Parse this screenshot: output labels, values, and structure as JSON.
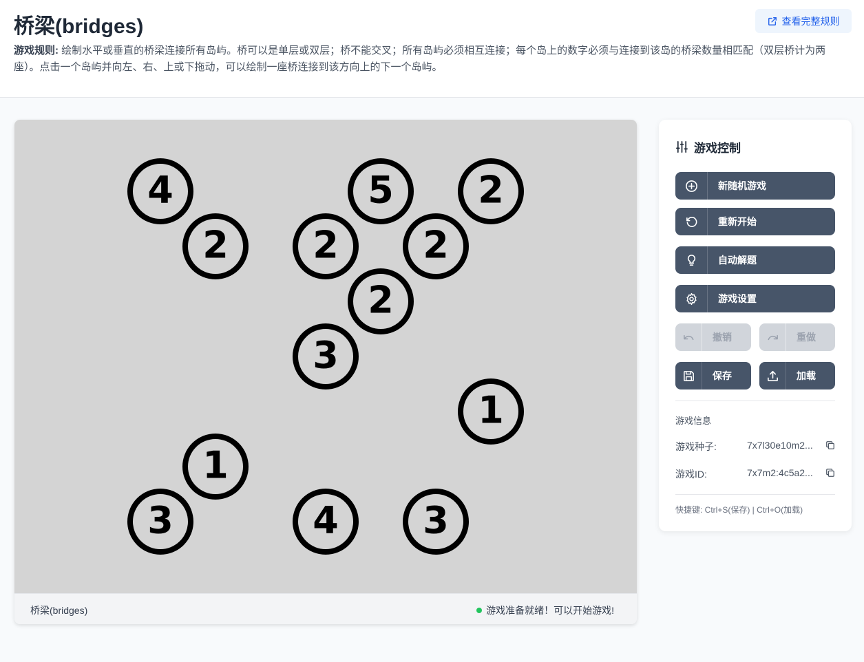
{
  "header": {
    "title": "桥梁(bridges)",
    "rules_label": "游戏规则:",
    "rules_text": "绘制水平或垂直的桥梁连接所有岛屿。桥可以是单层或双层；桥不能交叉；所有岛屿必须相互连接；每个岛上的数字必须与连接到该岛的桥梁数量相匹配（双层桥计为两座）。点击一个岛屿并向左、右、上或下拖动，可以绘制一座桥连接到该方向上的下一个岛屿。",
    "rules_link": "查看完整规则"
  },
  "board": {
    "grid_cols": 11,
    "grid_rows": 8,
    "islands": [
      {
        "col": 2,
        "row": 0,
        "value": "4"
      },
      {
        "col": 6,
        "row": 0,
        "value": "5"
      },
      {
        "col": 8,
        "row": 0,
        "value": "2"
      },
      {
        "col": 3,
        "row": 1,
        "value": "2"
      },
      {
        "col": 5,
        "row": 1,
        "value": "2"
      },
      {
        "col": 7,
        "row": 1,
        "value": "2"
      },
      {
        "col": 6,
        "row": 2,
        "value": "2"
      },
      {
        "col": 5,
        "row": 3,
        "value": "3"
      },
      {
        "col": 8,
        "row": 4,
        "value": "1"
      },
      {
        "col": 3,
        "row": 5,
        "value": "1"
      },
      {
        "col": 2,
        "row": 6,
        "value": "3"
      },
      {
        "col": 5,
        "row": 6,
        "value": "4"
      },
      {
        "col": 7,
        "row": 6,
        "value": "3"
      }
    ],
    "colors": {
      "background": "#d4d4d4",
      "island_stroke": "#000000",
      "island_fill": "none"
    }
  },
  "footer": {
    "title": "桥梁(bridges)",
    "status": "游戏准备就绪！可以开始游戏!",
    "status_color": "#22c55e"
  },
  "panel": {
    "heading": "游戏控制",
    "buttons": {
      "new_game": "新随机游戏",
      "restart": "重新开始",
      "solve": "自动解题",
      "settings": "游戏设置",
      "undo": "撤销",
      "redo": "重做",
      "save": "保存",
      "load": "加载"
    },
    "info_title": "游戏信息",
    "seed_label": "游戏种子:",
    "seed_value": "7x7l30e10m2...",
    "id_label": "游戏ID:",
    "id_value": "7x7m2:4c5a2...",
    "shortcut": "快捷键: Ctrl+S(保存) | Ctrl+O(加载)"
  }
}
